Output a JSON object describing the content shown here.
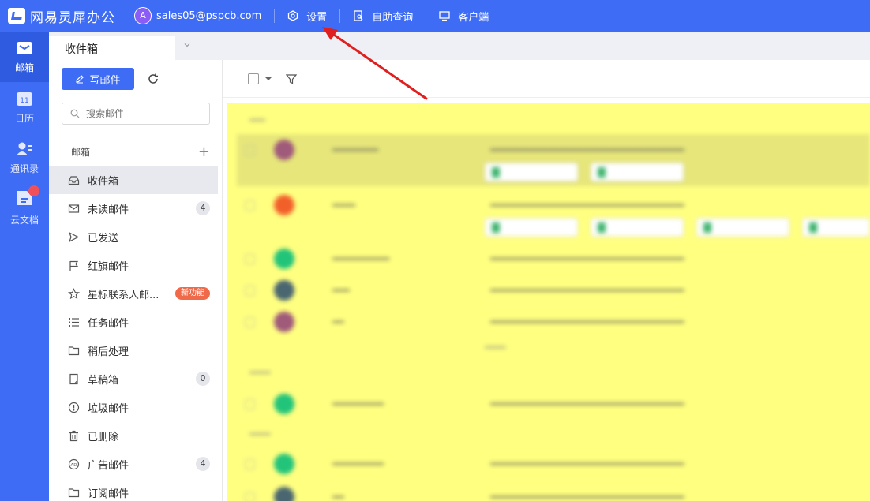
{
  "app": {
    "logo_text": "网易灵犀办公"
  },
  "header": {
    "avatar_letter": "A",
    "email": "sales05@pspcb.com",
    "links": [
      {
        "label": "设置",
        "icon": "settings-hexagon-icon"
      },
      {
        "label": "自助查询",
        "icon": "query-doc-icon"
      },
      {
        "label": "客户端",
        "icon": "desktop-client-icon"
      }
    ]
  },
  "rail": {
    "items": [
      {
        "label": "邮箱",
        "icon": "mail-icon",
        "active": true
      },
      {
        "label": "日历",
        "icon": "calendar-icon",
        "day": "11"
      },
      {
        "label": "通讯录",
        "icon": "contacts-icon"
      },
      {
        "label": "云文档",
        "icon": "cloud-doc-icon"
      }
    ]
  },
  "tabs": {
    "active_label": "收件箱"
  },
  "toolbar": {
    "compose_label": "写邮件"
  },
  "search": {
    "placeholder": "搜索邮件"
  },
  "mailbox": {
    "section_label": "邮箱",
    "folders": [
      {
        "label": "收件箱",
        "icon": "inbox-icon",
        "active": true
      },
      {
        "label": "未读邮件",
        "icon": "unread-mail-icon",
        "count": "4"
      },
      {
        "label": "已发送",
        "icon": "send-icon"
      },
      {
        "label": "红旗邮件",
        "icon": "flag-icon"
      },
      {
        "label": "星标联系人邮...",
        "icon": "star-icon",
        "tag": "新功能"
      },
      {
        "label": "任务邮件",
        "icon": "task-list-icon"
      },
      {
        "label": "稍后处理",
        "icon": "folder-later-icon"
      },
      {
        "label": "草稿箱",
        "icon": "draft-icon",
        "count": "0"
      },
      {
        "label": "垃圾邮件",
        "icon": "spam-icon"
      },
      {
        "label": "已删除",
        "icon": "trash-icon"
      },
      {
        "label": "广告邮件",
        "icon": "ad-icon",
        "count": "4"
      },
      {
        "label": "订阅邮件",
        "icon": "subscription-folder-icon"
      }
    ]
  },
  "colors": {
    "brand": "#3e6cf5",
    "highlight": "#ffff80",
    "annotation": "#e02020"
  }
}
